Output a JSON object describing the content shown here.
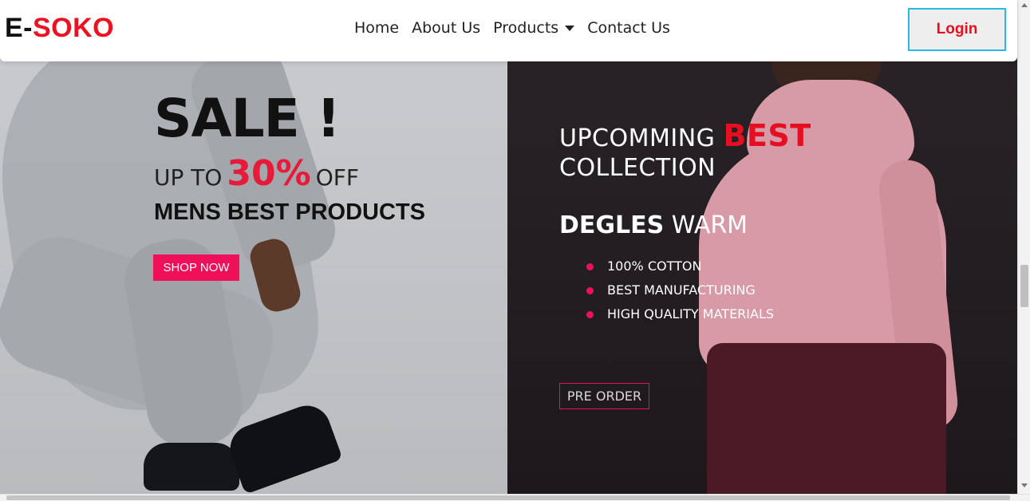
{
  "brand": {
    "part1": "E-",
    "part2": "SOKO"
  },
  "nav": {
    "items": [
      {
        "label": "Home"
      },
      {
        "label": "About Us"
      },
      {
        "label": "Products"
      },
      {
        "label": "Contact Us"
      }
    ],
    "login_label": "Login"
  },
  "left_banner": {
    "headline": "SALE !",
    "upto_prefix": "UP TO",
    "discount": "30%",
    "upto_suffix": "OFF",
    "subheadline": "MENS BEST PRODUCTS",
    "cta_label": "SHOP NOW"
  },
  "right_banner": {
    "title_line1_prefix": "UPCOMMING",
    "title_highlight": "BEST",
    "title_line2": "COLLECTION",
    "product_bold": "DEGLES",
    "product_light": "WARM",
    "features": [
      "100% COTTON",
      "BEST MANUFACTURING",
      "HIGH QUALITY MATERIALS"
    ],
    "cta_label": "PRE ORDER"
  },
  "colors": {
    "accent_red": "#e40f20",
    "cta_pink": "#f0105a",
    "login_border": "#2bb7e8"
  }
}
